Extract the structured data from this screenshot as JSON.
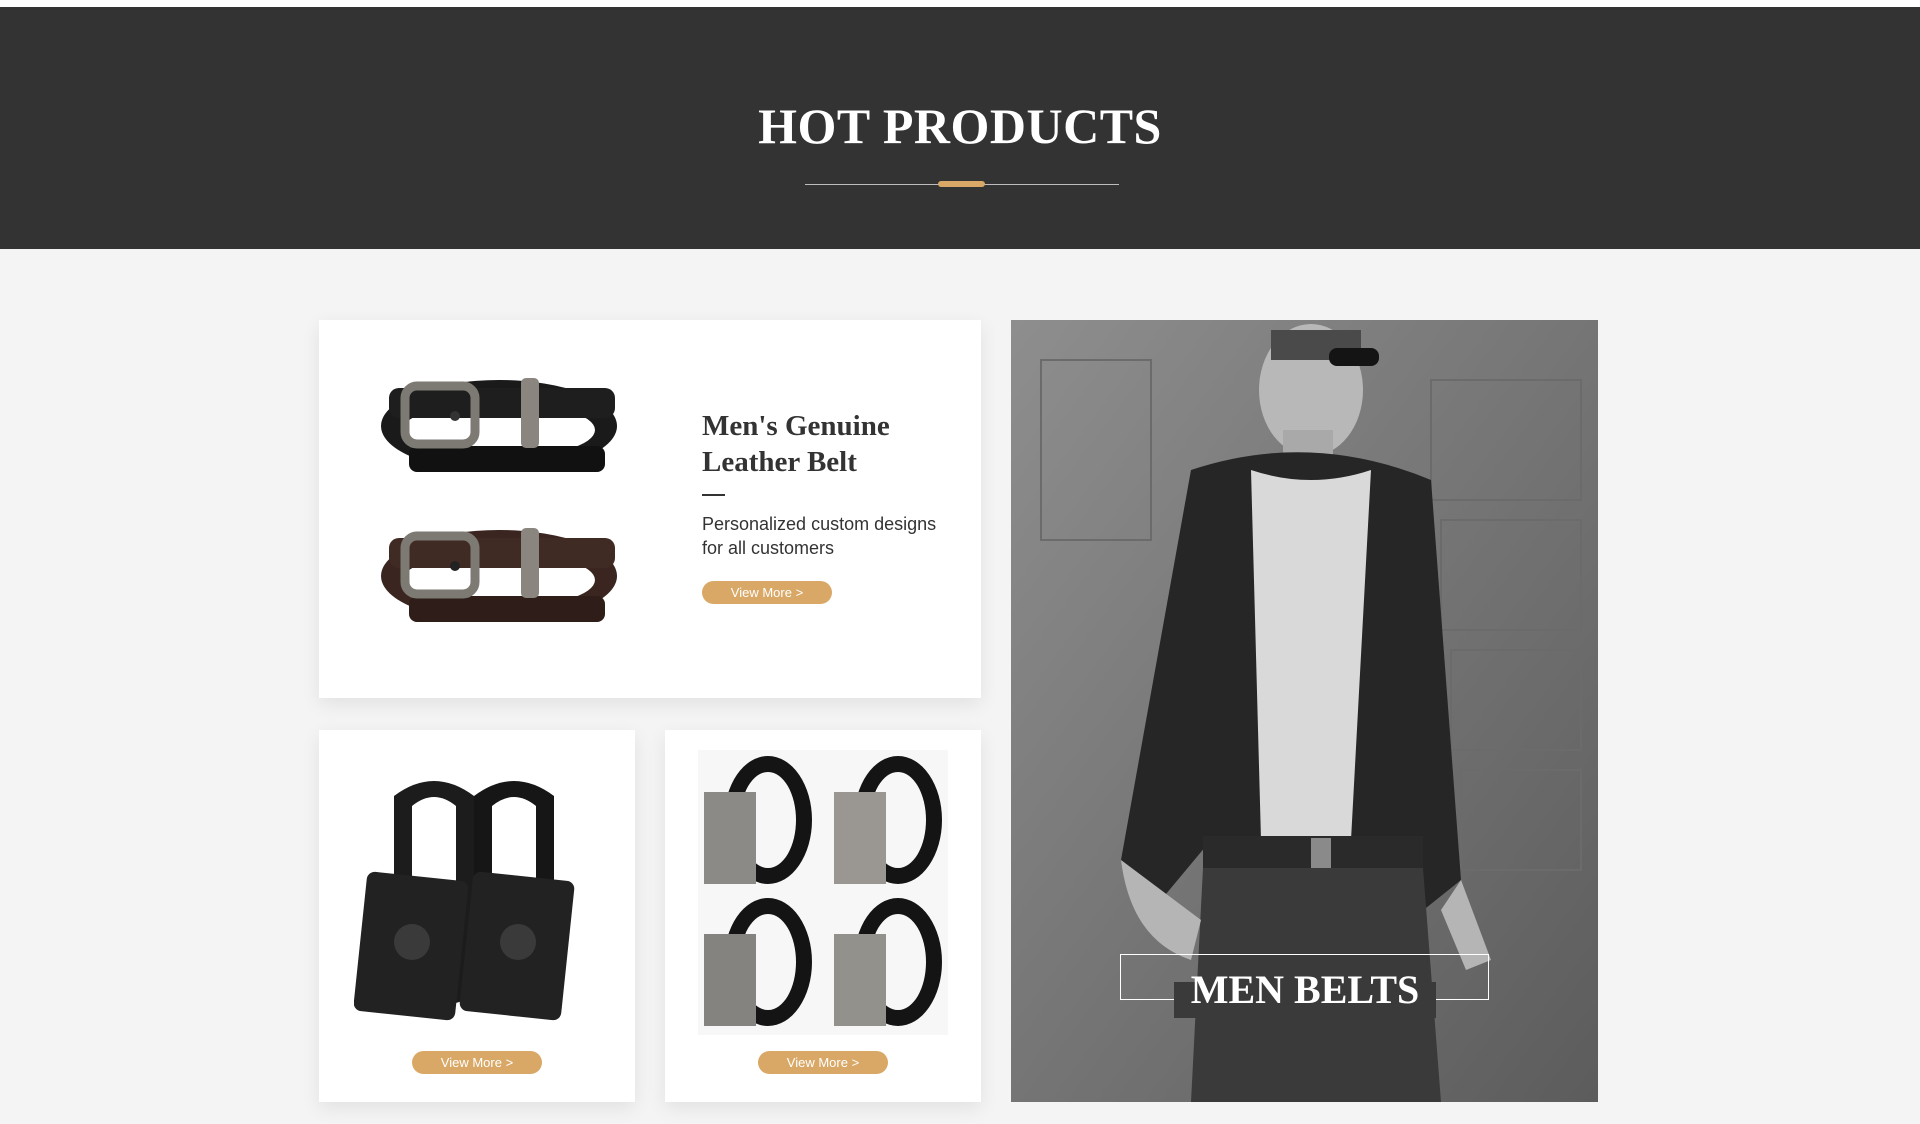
{
  "header": {
    "title": "HOT PRODUCTS"
  },
  "featured": {
    "title": "Men's Genuine Leather Belt",
    "description": "Personalized custom designs for all customers",
    "button_label": "View More >"
  },
  "products": [
    {
      "button_label": "View More >"
    },
    {
      "button_label": "View More >"
    }
  ],
  "promo": {
    "label": "MEN BELTS"
  },
  "colors": {
    "header_bg": "#333333",
    "accent": "#d9a866",
    "page_bg": "#f4f4f4"
  }
}
